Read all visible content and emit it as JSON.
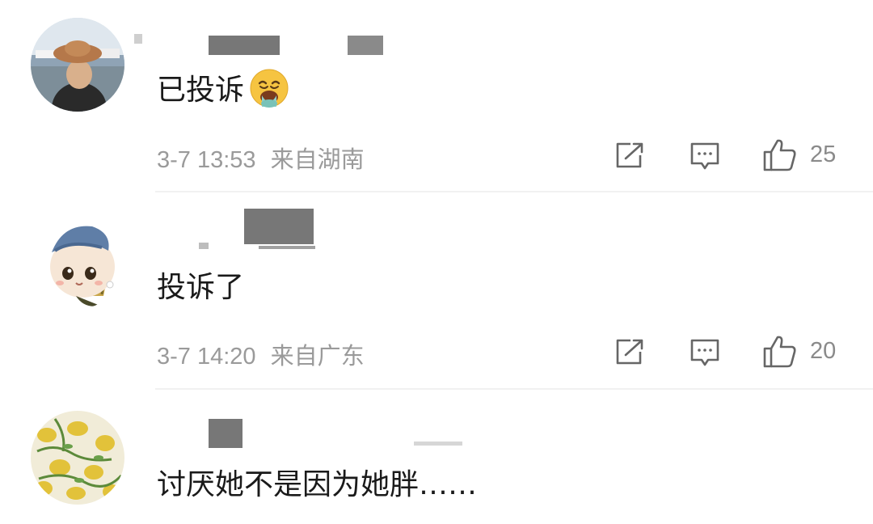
{
  "comments": [
    {
      "text": "已投诉",
      "emoji": "nauseated-face-emoji",
      "time": "3-7 13:53",
      "location": "来自湖南",
      "likes": "25"
    },
    {
      "text": "投诉了",
      "time": "3-7 14:20",
      "location": "来自广东",
      "likes": "20"
    },
    {
      "text": "讨厌她不是因为她胖……"
    }
  ],
  "icons": {
    "share": "share-icon",
    "reply": "comment-icon",
    "like": "thumbs-up-icon"
  },
  "colors": {
    "meta_text": "#9a9a9a",
    "redaction": "#777777",
    "divider": "#f1f1f1"
  }
}
